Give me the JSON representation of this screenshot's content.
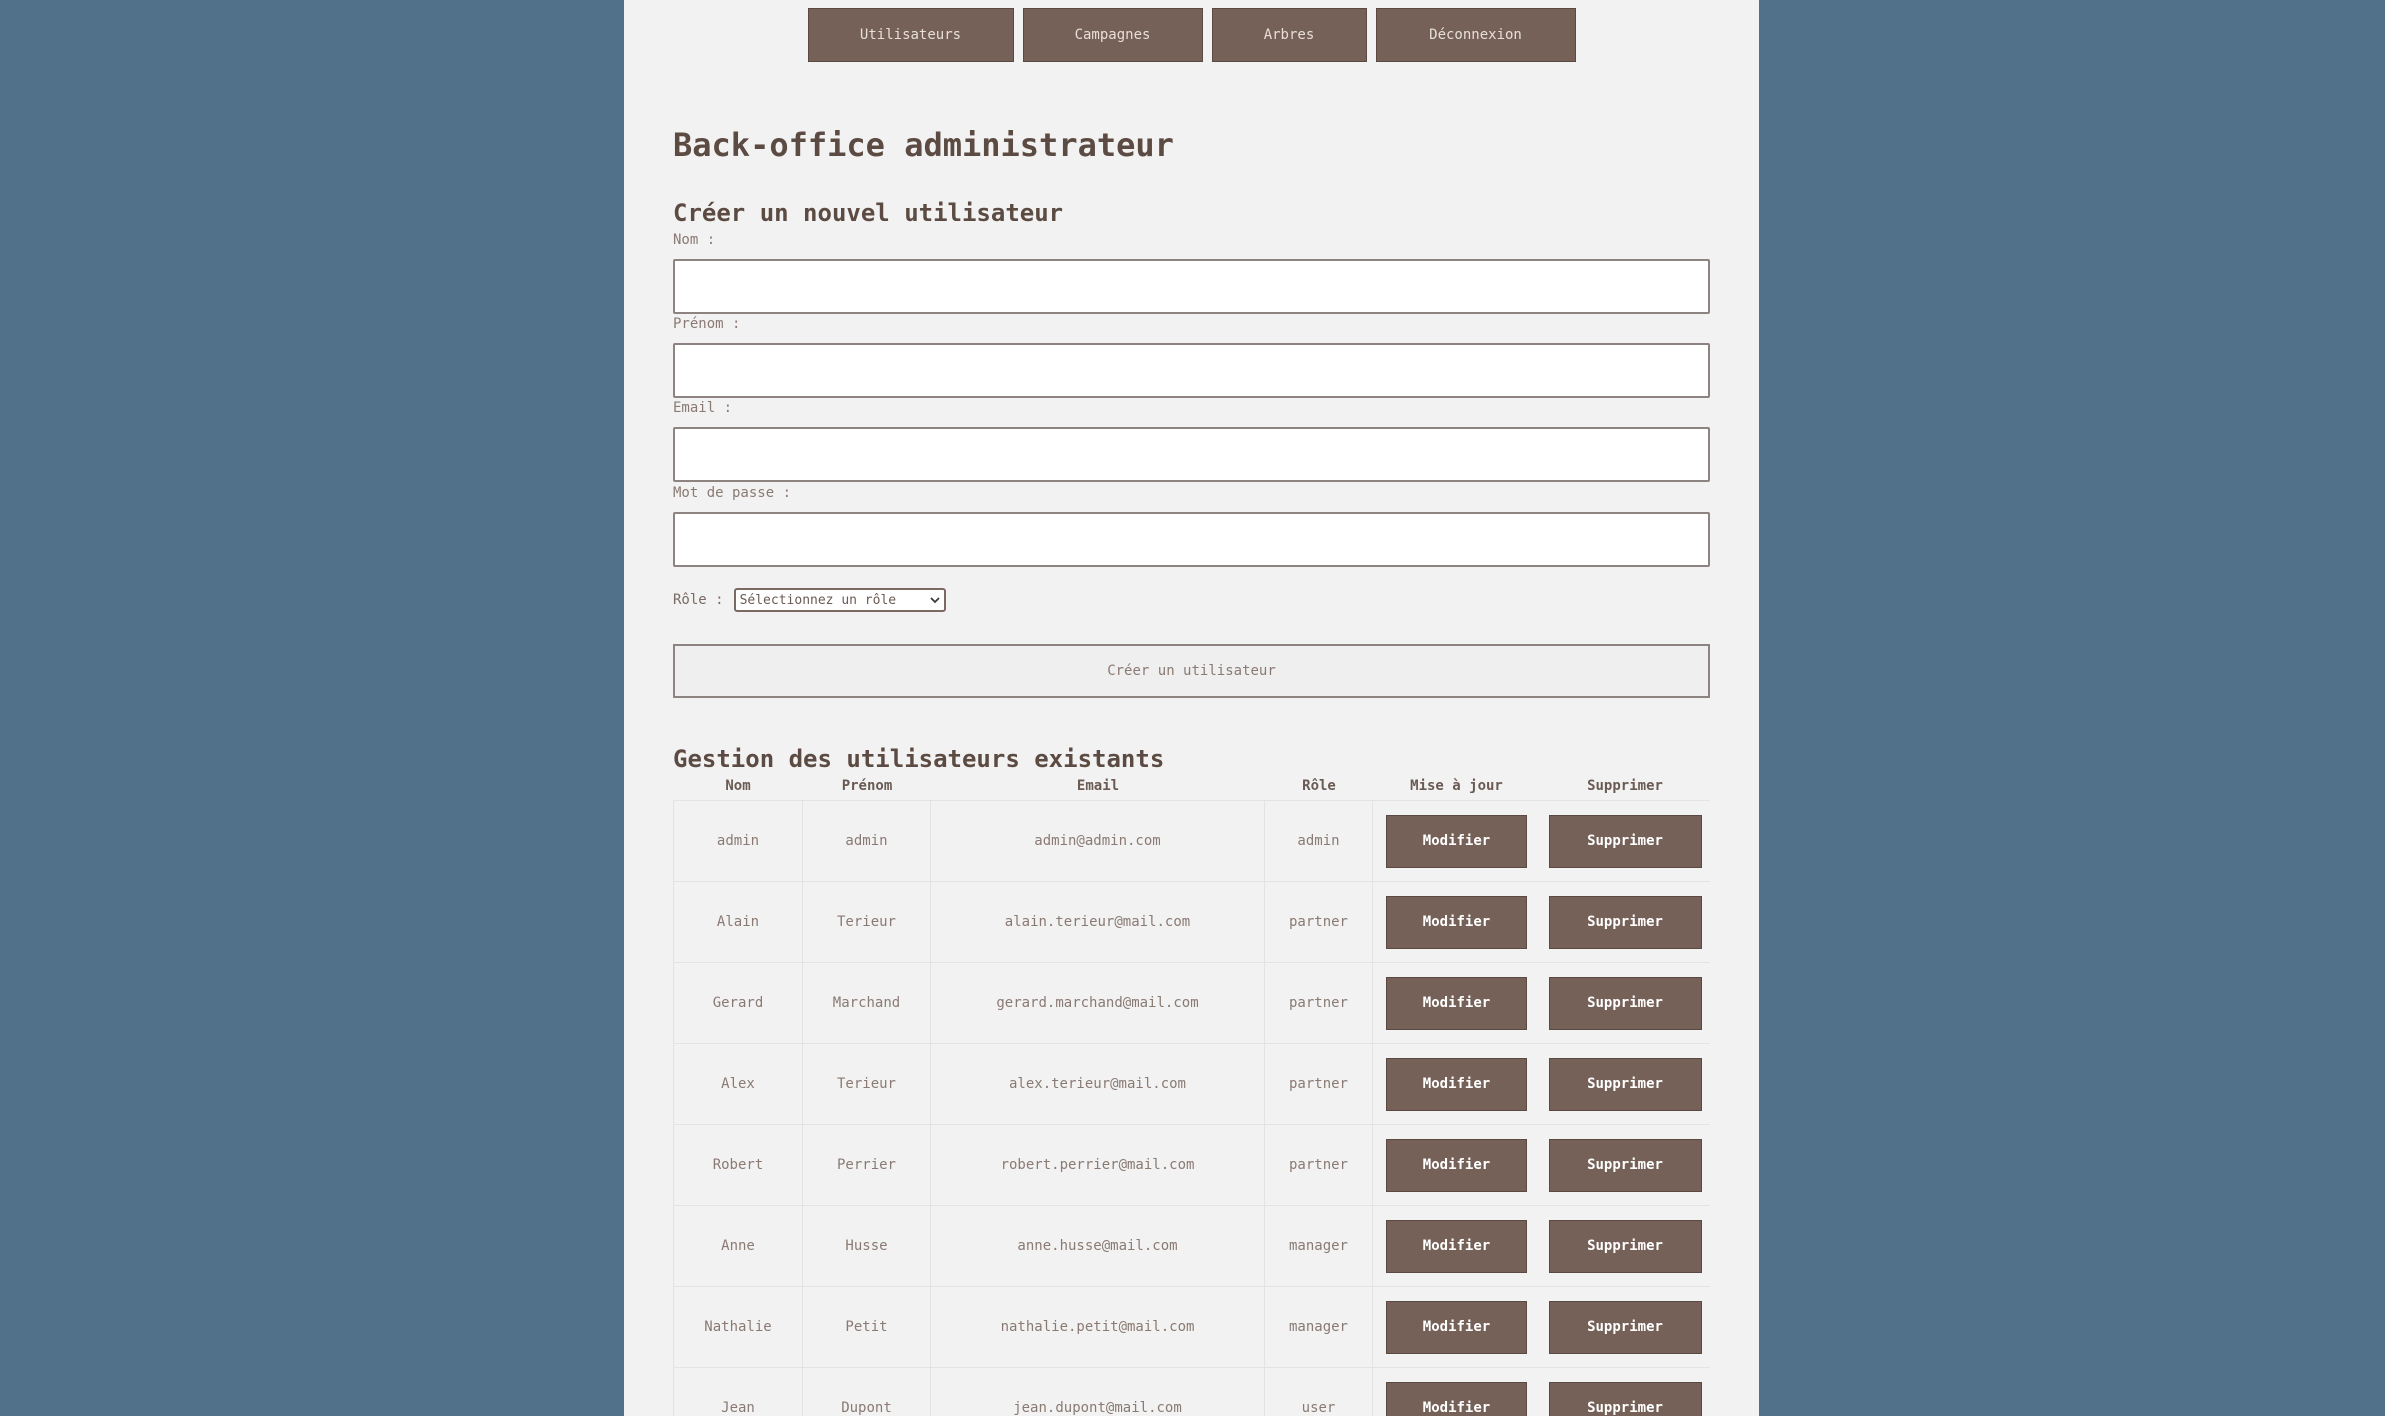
{
  "nav": {
    "items": [
      {
        "label": "Utilisateurs"
      },
      {
        "label": "Campagnes"
      },
      {
        "label": "Arbres"
      },
      {
        "label": "Déconnexion"
      }
    ]
  },
  "page": {
    "title": "Back-office administrateur"
  },
  "create_form": {
    "heading": "Créer un nouvel utilisateur",
    "nom_label": "Nom :",
    "nom_value": "",
    "prenom_label": "Prénom :",
    "prenom_value": "",
    "email_label": "Email :",
    "email_value": "",
    "password_label": "Mot de passe :",
    "password_value": "",
    "role_label": "Rôle :",
    "role_selected": "Sélectionnez un rôle",
    "submit_label": "Créer un utilisateur"
  },
  "users_section": {
    "heading": "Gestion des utilisateurs existants",
    "columns": [
      "Nom",
      "Prénom",
      "Email",
      "Rôle",
      "Mise à jour",
      "Supprimer"
    ],
    "modify_label": "Modifier",
    "delete_label": "Supprimer",
    "rows": [
      {
        "nom": "admin",
        "prenom": "admin",
        "email": "admin@admin.com",
        "role": "admin"
      },
      {
        "nom": "Alain",
        "prenom": "Terieur",
        "email": "alain.terieur@mail.com",
        "role": "partner"
      },
      {
        "nom": "Gerard",
        "prenom": "Marchand",
        "email": "gerard.marchand@mail.com",
        "role": "partner"
      },
      {
        "nom": "Alex",
        "prenom": "Terieur",
        "email": "alex.terieur@mail.com",
        "role": "partner"
      },
      {
        "nom": "Robert",
        "prenom": "Perrier",
        "email": "robert.perrier@mail.com",
        "role": "partner"
      },
      {
        "nom": "Anne",
        "prenom": "Husse",
        "email": "anne.husse@mail.com",
        "role": "manager"
      },
      {
        "nom": "Nathalie",
        "prenom": "Petit",
        "email": "nathalie.petit@mail.com",
        "role": "manager"
      },
      {
        "nom": "Jean",
        "prenom": "Dupont",
        "email": "jean.dupont@mail.com",
        "role": "user"
      }
    ]
  },
  "colors": {
    "background": "#517089",
    "panel": "#f2f2f2",
    "button": "#756158",
    "heading": "#5c4b43"
  }
}
